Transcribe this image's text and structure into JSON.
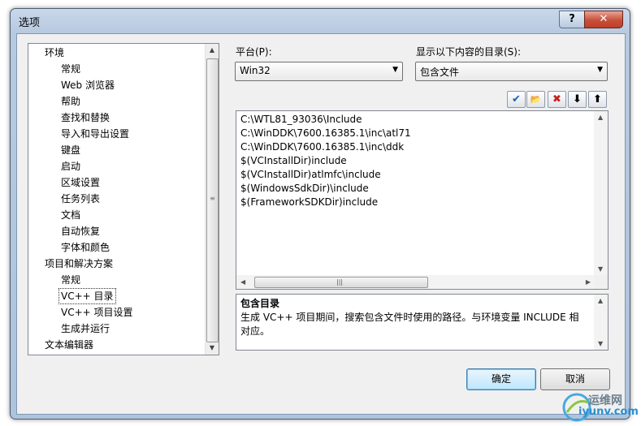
{
  "window": {
    "title": "选项",
    "help": "?",
    "close": "✕"
  },
  "tree": {
    "items": [
      {
        "label": "环境",
        "level": 0
      },
      {
        "label": "常规",
        "level": 1
      },
      {
        "label": "Web 浏览器",
        "level": 1
      },
      {
        "label": "帮助",
        "level": 1
      },
      {
        "label": "查找和替换",
        "level": 1
      },
      {
        "label": "导入和导出设置",
        "level": 1
      },
      {
        "label": "键盘",
        "level": 1
      },
      {
        "label": "启动",
        "level": 1
      },
      {
        "label": "区域设置",
        "level": 1
      },
      {
        "label": "任务列表",
        "level": 1
      },
      {
        "label": "文档",
        "level": 1
      },
      {
        "label": "自动恢复",
        "level": 1
      },
      {
        "label": "字体和颜色",
        "level": 1
      },
      {
        "label": "项目和解决方案",
        "level": 0
      },
      {
        "label": "常规",
        "level": 1
      },
      {
        "label": "VC++ 目录",
        "level": 1,
        "selected": true
      },
      {
        "label": "VC++ 项目设置",
        "level": 1
      },
      {
        "label": "生成并运行",
        "level": 1
      },
      {
        "label": "文本编辑器",
        "level": 0
      }
    ]
  },
  "platform": {
    "label": "平台(P):",
    "value": "Win32"
  },
  "dirs_for": {
    "label": "显示以下内容的目录(S):",
    "value": "包含文件"
  },
  "toolbar": {
    "check": "✔",
    "folder": "📂",
    "delete": "✖",
    "down": "⬇",
    "up": "⬆"
  },
  "directories": [
    "C:\\WTL81_93036\\Include",
    "C:\\WinDDK\\7600.16385.1\\inc\\atl71",
    "C:\\WinDDK\\7600.16385.1\\inc\\ddk",
    "$(VCInstallDir)include",
    "$(VCInstallDir)atlmfc\\include",
    "$(WindowsSdkDir)\\include",
    "$(FrameworkSDKDir)include"
  ],
  "description": {
    "title": "包含目录",
    "body": "生成 VC++ 项目期间，搜索包含文件时使用的路径。与环境变量 INCLUDE 相对应。"
  },
  "buttons": {
    "ok": "确定",
    "cancel": "取消"
  },
  "watermark": {
    "line1": "运维网",
    "line2": "iyunv.com"
  },
  "colors": {
    "close": "#c84f3a",
    "default_button": "#3c7fb1",
    "watermark": "#2a8fd0"
  }
}
